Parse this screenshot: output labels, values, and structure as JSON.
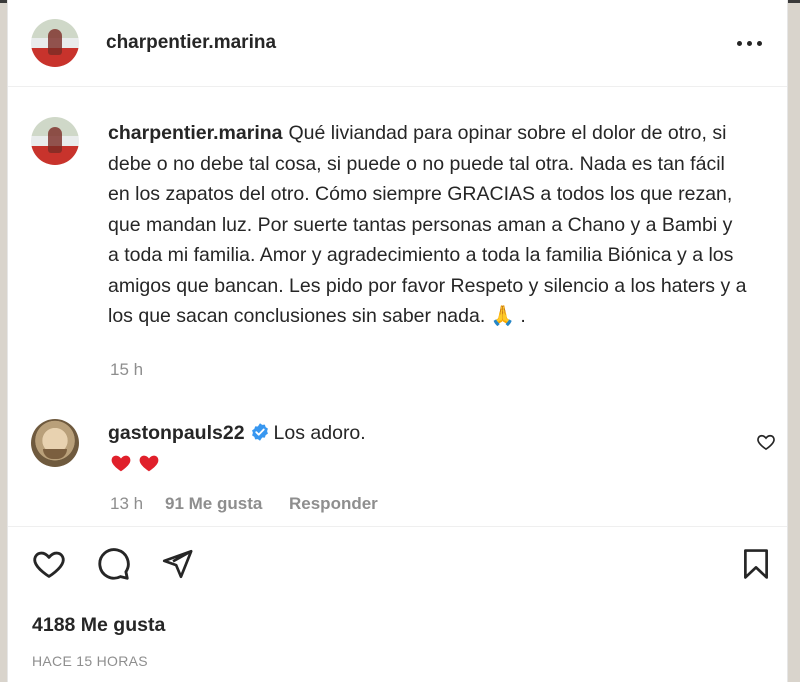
{
  "post": {
    "author": "charpentier.marina",
    "more_icon": "more-horizontal-icon"
  },
  "caption": {
    "username": "charpentier.marina",
    "text": "Qué liviandad para opinar sobre el dolor de otro, si debe o no debe tal cosa, si puede o no puede tal otra. Nada es tan fácil en los zapatos del otro. Cómo siempre GRACIAS a todos los que rezan, que mandan luz. Por suerte tantas personas aman a Chano y a Bambi y a toda mi familia. Amor y agradecimiento a toda la familia Biónica y a los amigos que bancan. Les pido por favor Respeto y silencio a los haters y a los que sacan conclusiones sin saber nada.",
    "emoji": "🙏",
    "trailing": " .",
    "time": "15 h"
  },
  "comment": {
    "username": "gastonpauls22",
    "verified": true,
    "text": "Los adoro.",
    "emoji_line": [
      "heart-emoji",
      "heart-emoji"
    ],
    "time": "13 h",
    "likes": "91 Me gusta",
    "reply_label": "Responder"
  },
  "actions": {
    "icons": [
      "heart-icon",
      "comment-icon",
      "share-icon",
      "bookmark-icon"
    ]
  },
  "likes_count": "4188 Me gusta",
  "timestamp": "HACE 15 HORAS",
  "colors": {
    "text": "#262626",
    "secondary": "#8e8e8e",
    "verified": "#3897f0",
    "heart": "#e0202b"
  }
}
